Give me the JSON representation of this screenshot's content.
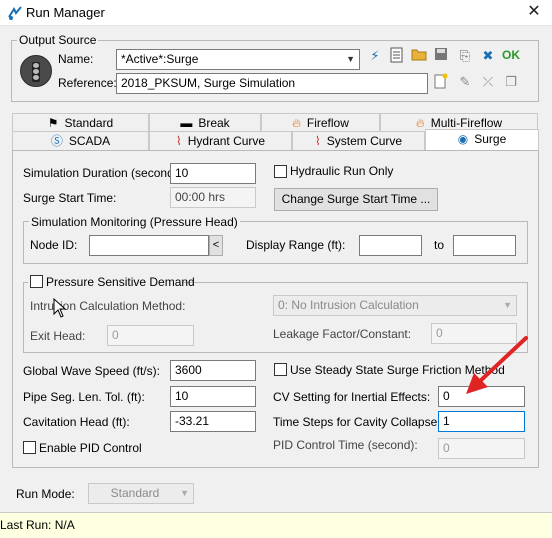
{
  "window": {
    "title": "Run Manager",
    "close_glyph": "✕",
    "icon": "run-manager-icon"
  },
  "output_source": {
    "group_label": "Output Source",
    "name_label": "Name:",
    "name_value": "*Active*:Surge",
    "reference_label": "Reference:",
    "reference_value": "2018_PKSUM, Surge Simulation",
    "ok_label": "OK",
    "toolbar_icons": [
      "run-icon",
      "document-icon",
      "open-folder-icon",
      "save-icon",
      "clear-icon",
      "cancel-run-icon",
      "ok-icon"
    ],
    "reference_icons": [
      "new-icon",
      "edit-icon",
      "remove-icon",
      "copy-icon"
    ]
  },
  "tabs_row1": [
    {
      "label": "Standard",
      "icon": "standard-icon"
    },
    {
      "label": "Break",
      "icon": "break-icon"
    },
    {
      "label": "Fireflow",
      "icon": "fire-icon"
    },
    {
      "label": "Multi-Fireflow",
      "icon": "multi-fire-icon"
    }
  ],
  "tabs_row2": [
    {
      "label": "SCADA",
      "icon": "scada-icon"
    },
    {
      "label": "Hydrant Curve",
      "icon": "hydrant-curve-icon"
    },
    {
      "label": "System Curve",
      "icon": "system-curve-icon"
    },
    {
      "label": "Surge",
      "icon": "surge-icon",
      "active": true
    }
  ],
  "surge": {
    "sim_duration_label": "Simulation Duration (second):",
    "sim_duration_value": "10",
    "hydraulic_run_only_label": "Hydraulic Run Only",
    "surge_start_label": "Surge Start Time:",
    "surge_start_value": "00:00 hrs",
    "change_start_button": "Change Surge Start Time ...",
    "monitoring_group_label": "Simulation Monitoring (Pressure Head)",
    "node_id_label": "Node ID:",
    "node_id_value": "",
    "node_id_button": "<",
    "display_range_label": "Display Range (ft):",
    "display_range_from": "",
    "to_label": "to",
    "display_range_to": "",
    "pressure_sensitive_label": "Pressure Sensitive Demand",
    "intrusion_method_label": "Intrusion Calculation Method:",
    "intrusion_method_value": "0: No Intrusion Calculation",
    "exit_head_label": "Exit Head:",
    "exit_head_value": "0",
    "leakage_label": "Leakage Factor/Constant:",
    "leakage_value": "0",
    "wave_speed_label": "Global Wave Speed (ft/s):",
    "wave_speed_value": "3600",
    "steady_state_label": "Use Steady State Surge Friction Method",
    "pipe_seg_label": "Pipe Seg. Len. Tol. (ft):",
    "pipe_seg_value": "10",
    "cv_setting_label": "CV Setting for Inertial Effects:",
    "cv_setting_value": "0",
    "cavitation_label": "Cavitation Head (ft):",
    "cavitation_value": "-33.21",
    "time_steps_label": "Time Steps for Cavity Collapse:",
    "time_steps_value": "1",
    "enable_pid_label": "Enable PID Control",
    "pid_time_label": "PID Control Time (second):",
    "pid_time_value": "0"
  },
  "run_mode": {
    "label": "Run Mode:",
    "value": "Standard"
  },
  "status": {
    "last_run": "Last Run: N/A"
  },
  "colors": {
    "accent_red": "#e02424",
    "focus_blue": "#0078d7",
    "status_yellow": "#ffffe1"
  }
}
